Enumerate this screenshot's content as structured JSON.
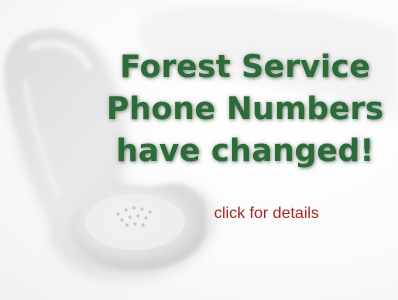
{
  "banner": {
    "headline": [
      "Forest Service",
      "Phone Numbers",
      "have changed!"
    ],
    "link_text": "click for details",
    "colors": {
      "headline": "#2d6b3b",
      "link": "#a62524",
      "background": "#ffffff"
    },
    "icon": "telephone-handset-icon"
  }
}
